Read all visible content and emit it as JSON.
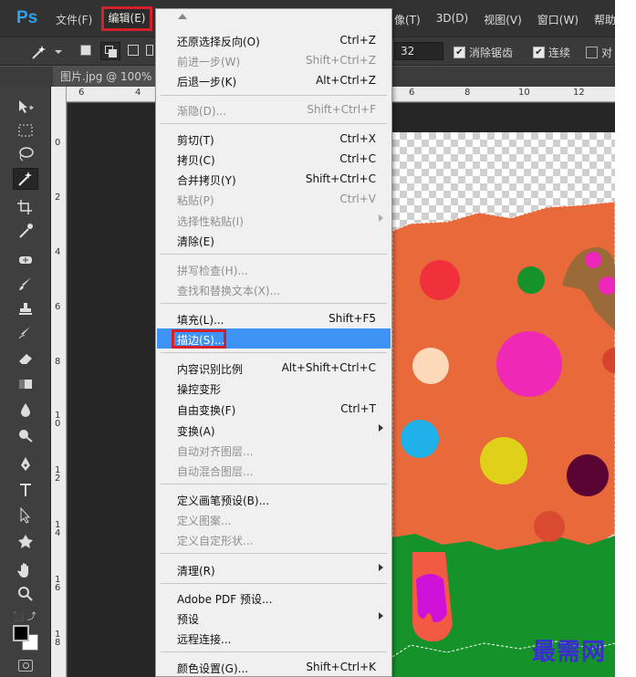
{
  "app": {
    "logo": "Ps"
  },
  "menubar": {
    "file": "文件(F)",
    "edit": "编辑(E)",
    "right_items": [
      "像(T)",
      "3D(D)",
      "视图(V)",
      "窗口(W)",
      "帮助"
    ]
  },
  "options": {
    "size": "32",
    "anti_alias": "消除锯齿",
    "contiguous": "连续",
    "sample_all": "对"
  },
  "document": {
    "tab_label": "图片.jpg @ 100%"
  },
  "rulers": {
    "h_labels": [
      "6",
      "4",
      "6",
      "8",
      "10",
      "12"
    ],
    "v_labels": [
      "0",
      "2",
      "4",
      "6",
      "8",
      "1 0",
      "1 2",
      "1 4",
      "1 6",
      "1 8"
    ]
  },
  "edit_menu": {
    "items": [
      {
        "label": "还原选择反向(O)",
        "shortcut": "Ctrl+Z",
        "disabled": false
      },
      {
        "label": "前进一步(W)",
        "shortcut": "Shift+Ctrl+Z",
        "disabled": true
      },
      {
        "label": "后退一步(K)",
        "shortcut": "Alt+Ctrl+Z",
        "disabled": false
      },
      {
        "label": "渐隐(D)...",
        "shortcut": "Shift+Ctrl+F",
        "disabled": true
      },
      {
        "label": "剪切(T)",
        "shortcut": "Ctrl+X",
        "disabled": false
      },
      {
        "label": "拷贝(C)",
        "shortcut": "Ctrl+C",
        "disabled": false
      },
      {
        "label": "合并拷贝(Y)",
        "shortcut": "Shift+Ctrl+C",
        "disabled": false
      },
      {
        "label": "粘贴(P)",
        "shortcut": "Ctrl+V",
        "disabled": true
      },
      {
        "label": "选择性粘贴(I)",
        "shortcut": "",
        "disabled": true,
        "submenu": true
      },
      {
        "label": "清除(E)",
        "shortcut": "",
        "disabled": false
      },
      {
        "label": "拼写检查(H)...",
        "shortcut": "",
        "disabled": true
      },
      {
        "label": "查找和替换文本(X)...",
        "shortcut": "",
        "disabled": true
      },
      {
        "label": "填充(L)...",
        "shortcut": "Shift+F5",
        "disabled": false
      },
      {
        "label": "描边(S)...",
        "shortcut": "",
        "disabled": false,
        "highlighted": true
      },
      {
        "label": "内容识别比例",
        "shortcut": "Alt+Shift+Ctrl+C",
        "disabled": false
      },
      {
        "label": "操控变形",
        "shortcut": "",
        "disabled": false
      },
      {
        "label": "自由变换(F)",
        "shortcut": "Ctrl+T",
        "disabled": false
      },
      {
        "label": "变换(A)",
        "shortcut": "",
        "disabled": false,
        "submenu": true
      },
      {
        "label": "自动对齐图层...",
        "shortcut": "",
        "disabled": true
      },
      {
        "label": "自动混合图层...",
        "shortcut": "",
        "disabled": true
      },
      {
        "label": "定义画笔预设(B)...",
        "shortcut": "",
        "disabled": false
      },
      {
        "label": "定义图案...",
        "shortcut": "",
        "disabled": true
      },
      {
        "label": "定义自定形状...",
        "shortcut": "",
        "disabled": true
      },
      {
        "label": "清理(R)",
        "shortcut": "",
        "disabled": false,
        "submenu": true
      },
      {
        "label": "Adobe PDF 预设...",
        "shortcut": "",
        "disabled": false
      },
      {
        "label": "预设",
        "shortcut": "",
        "disabled": false,
        "submenu": true
      },
      {
        "label": "远程连接...",
        "shortcut": "",
        "disabled": false
      },
      {
        "label": "颜色设置(G)...",
        "shortcut": "Shift+Ctrl+K",
        "disabled": false
      }
    ]
  },
  "watermark": "最需网",
  "colors": {
    "accent_highlight": "#3d93f4",
    "callout_red": "#d3202a",
    "ps_blue": "#2fa3f0",
    "orange": "#e8693a",
    "green": "#16922a"
  },
  "icons": {
    "tools": [
      "move-tool-icon",
      "marquee-tool-icon",
      "lasso-tool-icon",
      "magic-wand-tool-icon",
      "brush-tool-icon",
      "eyedropper-tool-icon",
      "healing-tool-icon",
      "pencil-tool-icon",
      "stamp-tool-icon",
      "history-brush-icon",
      "eraser-tool-icon",
      "gradient-tool-icon",
      "blur-tool-icon",
      "dodge-tool-icon",
      "pen-tool-icon",
      "type-tool-icon",
      "path-select-tool-icon",
      "shape-tool-icon",
      "hand-tool-icon",
      "zoom-tool-icon"
    ]
  }
}
